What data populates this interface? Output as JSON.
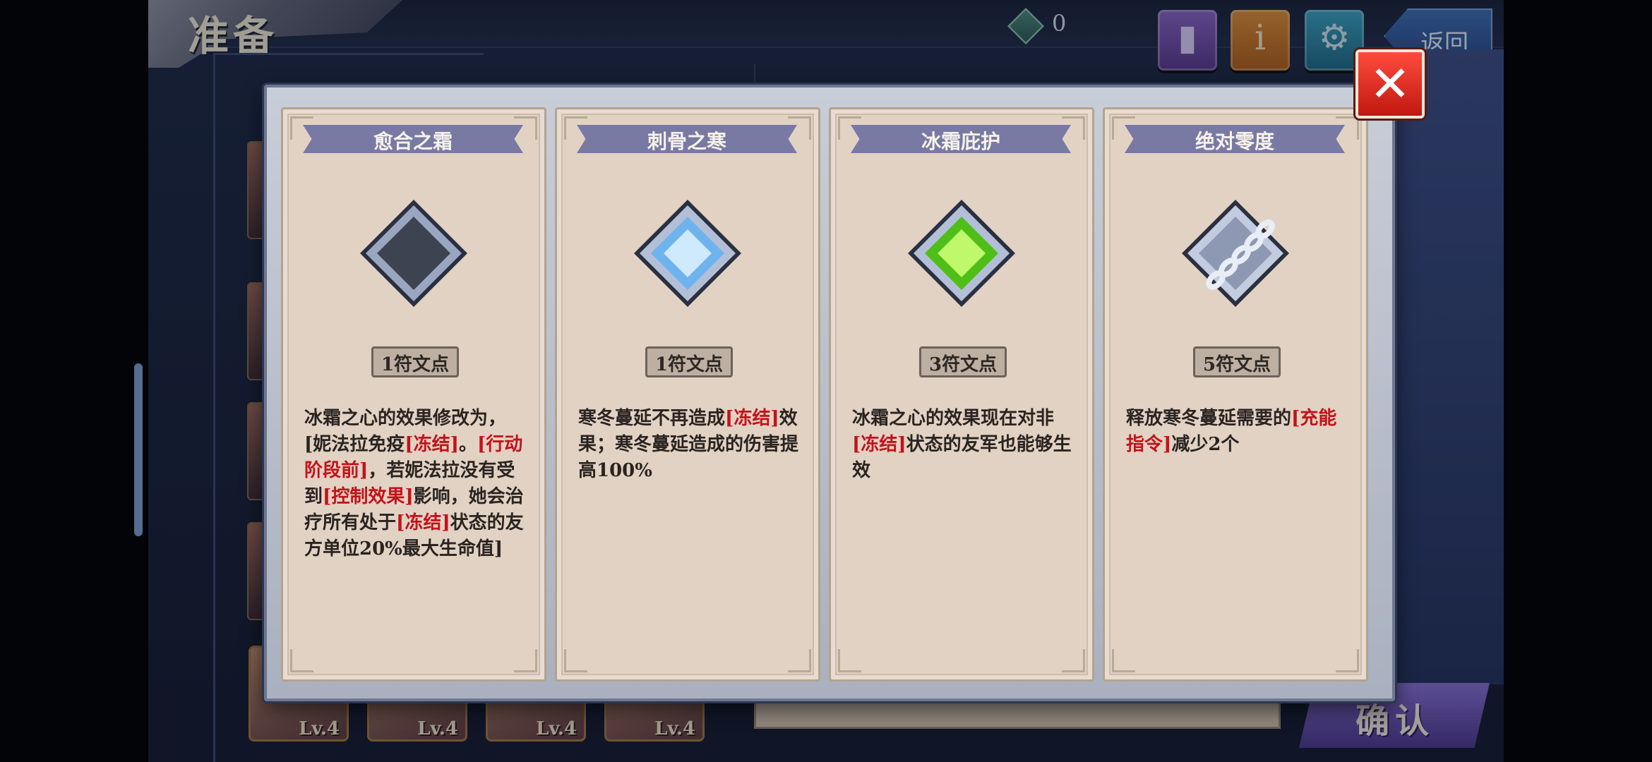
{
  "header": {
    "title": "准备",
    "gem_count": "0",
    "back_label": "返回"
  },
  "footer": {
    "confirm_label": "确认",
    "levels": [
      "Lv.4",
      "Lv.4",
      "Lv.4",
      "Lv.4"
    ]
  },
  "modal": {
    "close_label": "✕",
    "cards": [
      {
        "title": "愈合之霜",
        "gem": "dark-diamond-icon",
        "cost": "1符文点",
        "desc": [
          {
            "t": "冰霜之心的效果修改为，[妮法拉免疫",
            "red": false
          },
          {
            "t": "[冻结]",
            "red": true
          },
          {
            "t": "。",
            "red": false
          },
          {
            "t": "[行动阶段前]",
            "red": true
          },
          {
            "t": "，若妮法拉没有受到",
            "red": false
          },
          {
            "t": "[控制效果]",
            "red": true
          },
          {
            "t": "影响，她会治疗所有处于",
            "red": false
          },
          {
            "t": "[冻结]",
            "red": true
          },
          {
            "t": "状态的友方单位20%最大生命值]",
            "red": false
          }
        ]
      },
      {
        "title": "刺骨之寒",
        "gem": "ice-diamond-icon",
        "cost": "1符文点",
        "desc": [
          {
            "t": "寒冬蔓延不再造成",
            "red": false
          },
          {
            "t": "[冻结]",
            "red": true
          },
          {
            "t": "效果；寒冬蔓延造成的伤害提高100%",
            "red": false
          }
        ]
      },
      {
        "title": "冰霜庇护",
        "gem": "green-diamond-icon",
        "cost": "3符文点",
        "desc": [
          {
            "t": "冰霜之心的效果现在对非",
            "red": false
          },
          {
            "t": "[冻结]",
            "red": true
          },
          {
            "t": "状态的友军也能够生效",
            "red": false
          }
        ]
      },
      {
        "title": "绝对零度",
        "gem": "chained-diamond-icon",
        "cost": "5符文点",
        "desc": [
          {
            "t": "释放寒冬蔓延需要的",
            "red": false
          },
          {
            "t": "[充能指令]",
            "red": true
          },
          {
            "t": "减少2个",
            "red": false
          }
        ]
      }
    ]
  },
  "colors": {
    "accent_red": "#c4121a",
    "card_bg": "#e2d2c4",
    "title_ribbon": "#787aa4"
  }
}
